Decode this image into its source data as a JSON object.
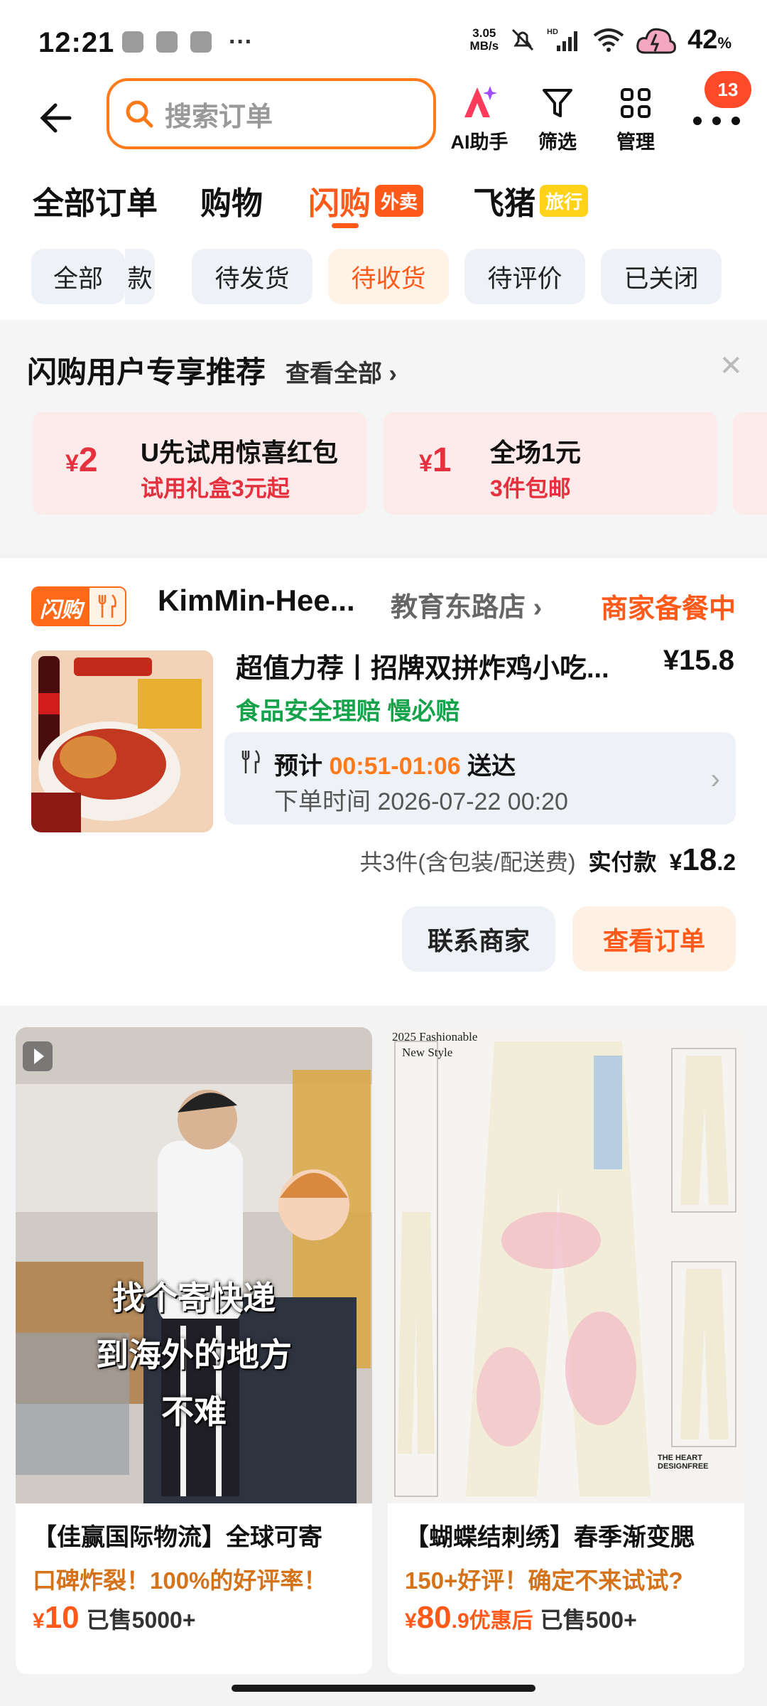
{
  "status_bar": {
    "time": "12:21",
    "net_speed_value": "3.05",
    "net_speed_unit": "MB/s",
    "network": "HD",
    "battery": "42",
    "battery_unit": "%"
  },
  "header": {
    "search_placeholder": "搜索订单",
    "ai_label": "AI助手",
    "filter_label": "筛选",
    "manage_label": "管理",
    "badge_count": "13"
  },
  "tabs": [
    {
      "label": "全部订单"
    },
    {
      "label": "购物"
    },
    {
      "label": "闪购",
      "tag": "外卖",
      "active": true
    },
    {
      "label": "飞猪",
      "tag": "旅行"
    }
  ],
  "chips": [
    {
      "label": "全部"
    },
    {
      "label": "款"
    },
    {
      "label": "待发货"
    },
    {
      "label": "待收货",
      "active": true
    },
    {
      "label": "待评价"
    },
    {
      "label": "已关闭"
    }
  ],
  "recommend": {
    "title": "闪购用户专享推荐",
    "view_all": "查看全部",
    "coupons": [
      {
        "symbol": "¥",
        "amount": "2",
        "title": "U先试用惊喜红包",
        "sub": "试用礼盒3元起"
      },
      {
        "symbol": "¥",
        "amount": "1",
        "title": "全场1元",
        "sub": "3件包邮"
      }
    ]
  },
  "order": {
    "shop_tag": "闪购",
    "shop_name": "KimMin-Hee...",
    "shop_branch": "教育东路店",
    "status": "商家备餐中",
    "product_title": "超值力荐丨招牌双拼炸鸡小吃...",
    "product_price": "¥15.8",
    "insurance": "食品安全理赔  慢必赔",
    "eta_prefix": "预计",
    "eta_time": "00:51-01:06",
    "eta_suffix": "送达",
    "order_time": "下单时间 2026-07-22 00:20",
    "summary": "共3件(含包装/配送费)",
    "paid_label": "实付款",
    "paid_symbol": "¥",
    "paid_int": "18",
    "paid_dec": ".2",
    "btn_contact": "联系商家",
    "btn_view": "查看订单"
  },
  "feed": [
    {
      "title": "【佳赢国际物流】全球可寄",
      "subtitle": "口碑炸裂！100%的好评率！",
      "price_symbol": "¥",
      "price": "10",
      "sold": "已售5000+",
      "overlay_lines": [
        "找个寄快递",
        "到海外的地方",
        "不难"
      ]
    },
    {
      "title": "【蝴蝶结刺绣】春季渐变腮",
      "subtitle": "150+好评！确定不来试试?",
      "price_symbol": "¥",
      "price": "80",
      "price_dec": ".9",
      "price_suffix": "优惠后",
      "sold": "已售500+",
      "caption_top": "2025 Fashionable",
      "caption_top2": "New Style",
      "caption_bottom": "THE HEART DESIGNFREE"
    }
  ],
  "colors": {
    "accent": "#ff5a1a",
    "coupon_red": "#e5303d",
    "insure_green": "#14a34a"
  }
}
